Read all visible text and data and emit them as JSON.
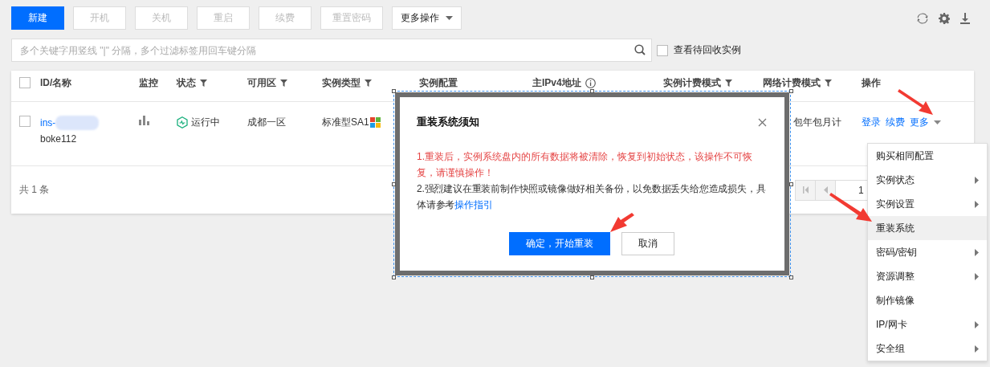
{
  "toolbar": {
    "buttons": [
      {
        "label": "新建",
        "kind": "primary",
        "disabled": false
      },
      {
        "label": "开机",
        "kind": "plain",
        "disabled": true
      },
      {
        "label": "关机",
        "kind": "plain",
        "disabled": true
      },
      {
        "label": "重启",
        "kind": "plain",
        "disabled": true
      },
      {
        "label": "续费",
        "kind": "plain",
        "disabled": true
      },
      {
        "label": "重置密码",
        "kind": "plain",
        "disabled": true
      },
      {
        "label": "更多操作",
        "kind": "dropdown",
        "disabled": false
      }
    ]
  },
  "search": {
    "placeholder": "多个关键字用竖线 \"|\" 分隔，多个过滤标签用回车键分隔"
  },
  "recycle_filter": {
    "label": "查看待回收实例",
    "checked": false
  },
  "table": {
    "columns": [
      {
        "label": "ID/名称",
        "filter": false,
        "info": false
      },
      {
        "label": "监控",
        "filter": false,
        "info": false
      },
      {
        "label": "状态",
        "filter": true,
        "info": false
      },
      {
        "label": "可用区",
        "filter": true,
        "info": false
      },
      {
        "label": "实例类型",
        "filter": true,
        "info": false
      },
      {
        "label": "实例配置",
        "filter": false,
        "info": false
      },
      {
        "label": "主IPv4地址",
        "filter": false,
        "info": true
      },
      {
        "label": "实例计费模式",
        "filter": true,
        "info": false
      },
      {
        "label": "网络计费模式",
        "filter": true,
        "info": false
      },
      {
        "label": "操作",
        "filter": false,
        "info": false
      }
    ],
    "all_selected": false,
    "rows": [
      {
        "selected": false,
        "id": "ins-",
        "name": "boke112",
        "status": "运行中",
        "zone": "成都一区",
        "type": "标准型SA1",
        "network_billing": "包年包月计",
        "actions": [
          "登录",
          "续费",
          "更多"
        ]
      }
    ],
    "total": "共 1 条",
    "page": "1"
  },
  "dialog": {
    "title": "重装系统须知",
    "warning": "1.重装后，实例系统盘内的所有数据将被清除，恢复到初始状态，该操作不可恢复，请谨慎操作！",
    "note": "2.强烈建议在重装前制作快照或镜像做好相关备份，以免数据丢失给您造成损失，具体请参考",
    "link": "操作指引",
    "confirm": "确定，开始重装",
    "cancel": "取消"
  },
  "menu": [
    {
      "label": "购买相同配置",
      "submenu": false,
      "selected": false
    },
    {
      "label": "实例状态",
      "submenu": true,
      "selected": false
    },
    {
      "label": "实例设置",
      "submenu": true,
      "selected": false
    },
    {
      "label": "重装系统",
      "submenu": false,
      "selected": true
    },
    {
      "label": "密码/密钥",
      "submenu": true,
      "selected": false
    },
    {
      "label": "资源调整",
      "submenu": true,
      "selected": false
    },
    {
      "label": "制作镜像",
      "submenu": false,
      "selected": false
    },
    {
      "label": "IP/网卡",
      "submenu": true,
      "selected": false
    },
    {
      "label": "安全组",
      "submenu": true,
      "selected": false
    }
  ]
}
